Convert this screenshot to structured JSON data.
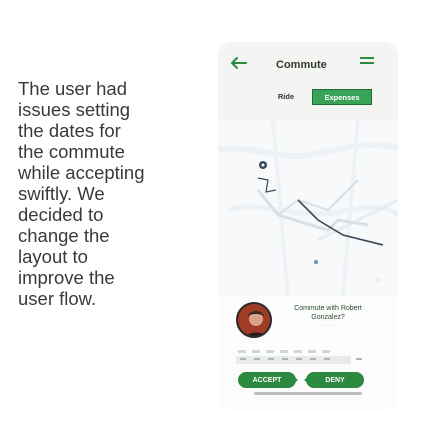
{
  "caption": "The user had\nissues setting\nthe dates for\nthe commute\nwhile accepting\nswiftly. We\ndecided to\nchange the\nlayout to\nimprove the\nuser flow.",
  "header": {
    "title": "Commute",
    "back_icon": "back-arrow-icon",
    "menu_icon": "menu-icon"
  },
  "segmented": {
    "ride_label": "Ride",
    "expenses_label": "Expenses",
    "selected": "Expenses",
    "accent": "#39a357"
  },
  "sheet": {
    "message": "Commute with Robert Gonzalez?",
    "buttons": {
      "accept": "ACCEPT",
      "deny": "DENY",
      "color": "#2b8a3e"
    }
  }
}
